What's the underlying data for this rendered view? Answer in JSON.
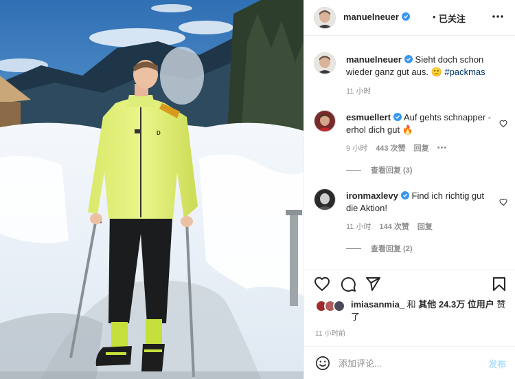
{
  "colors": {
    "accent": "#0095f6",
    "verified": "#3897f0",
    "muted": "#8e8e8e",
    "text": "#262626",
    "post_disabled": "#b2dffc"
  },
  "photo": {
    "jacket_logo": "D"
  },
  "header": {
    "username": "manuelneuer",
    "separator": "•",
    "follow_label": "已关注",
    "more_icon": "ellipsis-icon"
  },
  "comments": [
    {
      "username": "manuelneuer",
      "text": "Sieht doch schon wieder ganz gut aus. 🙂 ",
      "hashtag": "#packmas",
      "time": "11 小时"
    },
    {
      "username": "esmuellert",
      "text": "Auf gehts schnapper - erhol dich gut 🔥",
      "time": "9 小时",
      "likes": "443 次赞",
      "reply_label": "回复",
      "more": "•••",
      "view_replies": "查看回复 (3)"
    },
    {
      "username": "ironmaxlevy",
      "text": "Find ich richtig gut die Aktion!",
      "time": "11 小时",
      "likes": "144 次赞",
      "reply_label": "回复",
      "view_replies": "查看回复 (2)"
    }
  ],
  "likes": {
    "user": "imiasanmia_",
    "middle": " 和 ",
    "count_text": "其他 24.3万 位用户",
    "suffix": " 赞了"
  },
  "timestamp": "11 小时前",
  "comment_box": {
    "placeholder": "添加评论...",
    "post_label": "发布"
  }
}
